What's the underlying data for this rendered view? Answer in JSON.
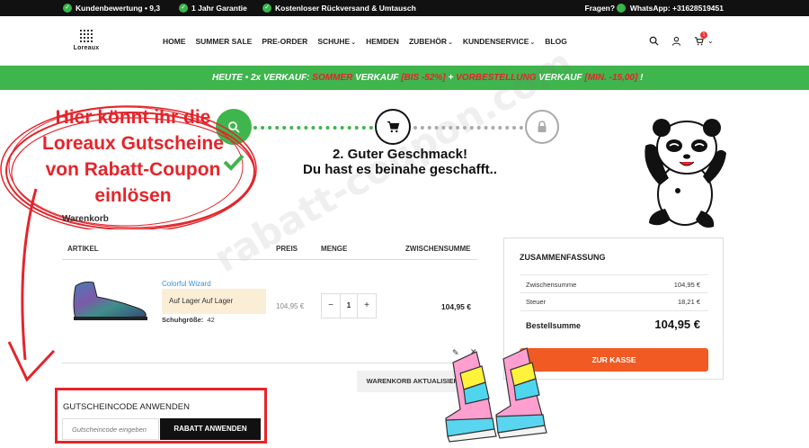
{
  "topbar": {
    "perk_1": "Kundenbewertung • 9,3",
    "perk_2": "1 Jahr Garantie",
    "perk_3": "Kostenloser Rückversand & Umtausch",
    "help": "Fragen?",
    "whatsapp": "WhatsApp: +31628519451"
  },
  "header": {
    "logo_text": "Loreaux",
    "nav": [
      "HOME",
      "SUMMER SALE",
      "PRE-ORDER",
      "SCHUHE",
      "HEMDEN",
      "ZUBEHÖR",
      "KUNDENSERVICE",
      "BLOG"
    ],
    "cart_count": "1",
    "icons": [
      "search-icon",
      "user-icon",
      "cart-icon"
    ]
  },
  "promo": {
    "prefix": "HEUTE • 2x VERKAUF:",
    "part_1": "SOMMER",
    "part_2": "VERKAUF",
    "part_3": "[BIS -52%]",
    "plus": "+",
    "part_4": "VORBESTELLUNG",
    "part_5": "VERKAUF",
    "part_6": "[MIN. -15,00]",
    "suffix": "!"
  },
  "steps": {
    "heading_line_1": "2. Guter Geschmack!",
    "heading_line_2": "Du hast es beinahe geschafft.."
  },
  "annotation": {
    "line_1": "Hier könnt ihr die",
    "line_2": "Loreaux Gutscheine",
    "line_3": "von Rabatt-Coupon",
    "line_4": "einlösen"
  },
  "cart": {
    "title": "Warenkorb",
    "columns": [
      "ARTIKEL",
      "PREIS",
      "MENGE",
      "ZWISCHENSUMME"
    ],
    "item": {
      "name": "Colorful Wizard",
      "stock": "Auf Lager Auf Lager",
      "size_label": "Schuhgröße:",
      "size_value": "42",
      "price": "104,95 €",
      "qty_minus": "−",
      "qty": "1",
      "qty_plus": "+",
      "subtotal": "104,95 €"
    },
    "update_button": "WARENKORB AKTUALISIEREN"
  },
  "summary": {
    "title": "ZUSAMMENFASSUNG",
    "subtotal_label": "Zwischensumme",
    "subtotal_value": "104,95 €",
    "tax_label": "Steuer",
    "tax_value": "18,21 €",
    "total_label": "Bestellsumme",
    "total_value": "104,95 €",
    "checkout_button": "ZUR KASSE"
  },
  "coupon": {
    "label": "GUTSCHEINCODE ANWENDEN",
    "placeholder": "Gutscheincode eingeben",
    "button": "RABATT ANWENDEN"
  },
  "watermark": "rabatt-coupon.com",
  "colors": {
    "green": "#3fb54d",
    "red": "#e4252b",
    "orange": "#f15a22",
    "link_blue": "#3a8fd8"
  }
}
